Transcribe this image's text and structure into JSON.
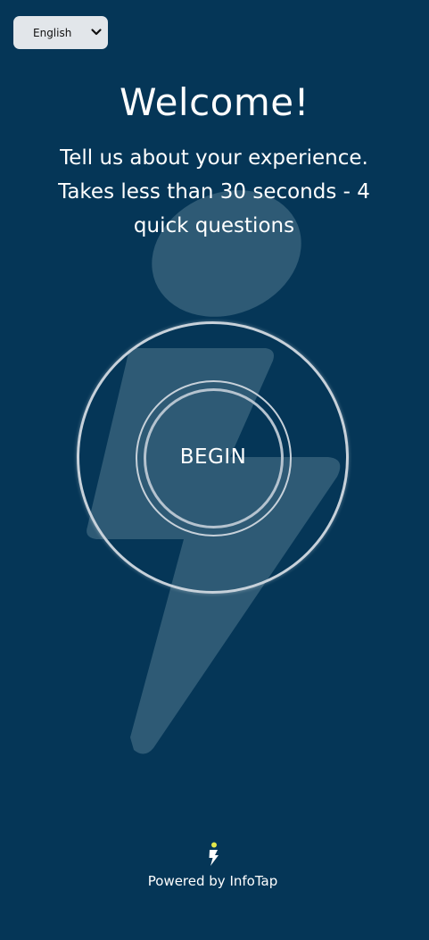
{
  "language": {
    "selected": "English"
  },
  "welcome": {
    "title": "Welcome!",
    "subtitle": "Tell us about your experience. Takes less than 30 seconds - 4 quick questions"
  },
  "begin": {
    "label": "BEGIN"
  },
  "footer": {
    "text": "Powered by InfoTap"
  },
  "colors": {
    "background": "#053657",
    "logo_watermark": "#2e5a75",
    "ring": "#c7d1da",
    "accent_yellow": "#e3e84a"
  },
  "icons": {
    "language_dropdown": "chevron-down-icon",
    "footer_logo": "infotap-bolt-icon",
    "background": "infotap-logo-watermark"
  }
}
